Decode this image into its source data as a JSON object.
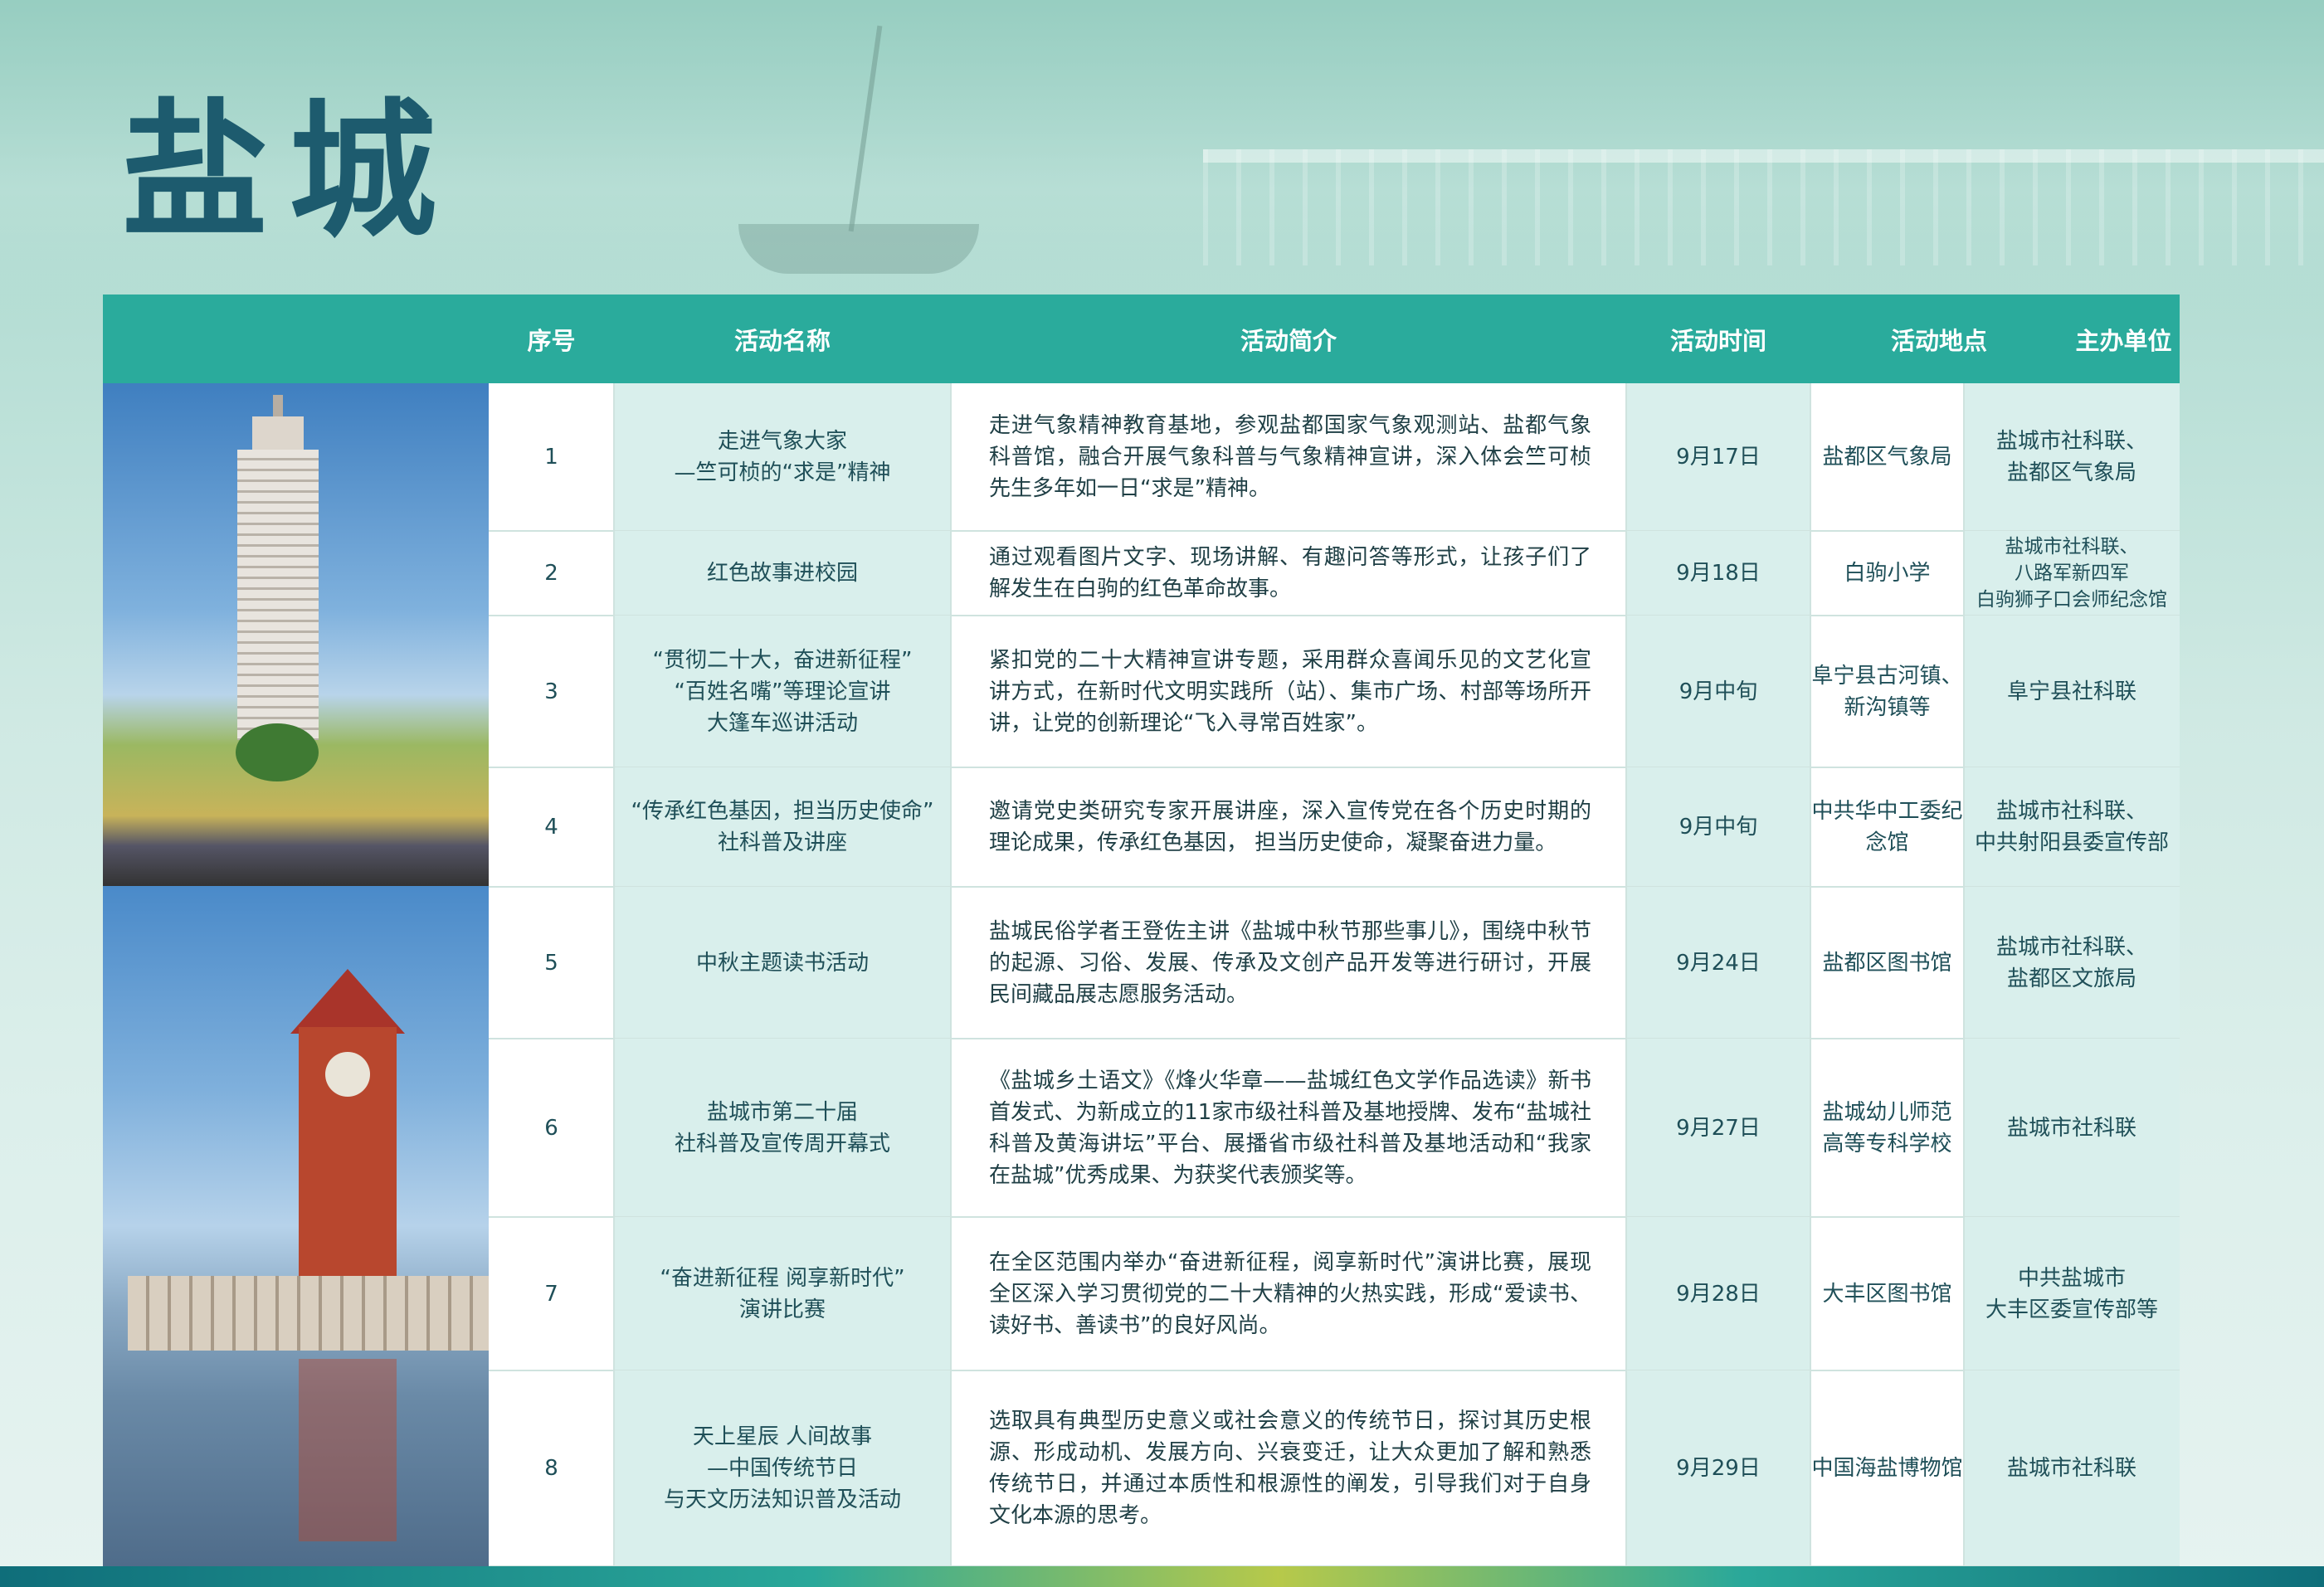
{
  "title": "盐城",
  "colors": {
    "header_bg": "#2aab9c",
    "title": "#1d5b6e",
    "shaded_cell": "#d9efec"
  },
  "table": {
    "headers": {
      "seq": "序号",
      "name": "活动名称",
      "desc": "活动简介",
      "time": "活动时间",
      "place": "活动地点",
      "host": "主办单位"
    },
    "rows": [
      {
        "seq": "1",
        "name": "走进气象大家\n—竺可桢的“求是”精神",
        "desc": "走进气象精神教育基地，参观盐都国家气象观测站、盐都气象科普馆，融合开展气象科普与气象精神宣讲，深入体会竺可桢先生多年如一日“求是”精神。",
        "time": "9月17日",
        "place": "盐都区气象局",
        "host": "盐城市社科联、\n盐都区气象局"
      },
      {
        "seq": "2",
        "name": "红色故事进校园",
        "desc": "通过观看图片文字、现场讲解、有趣问答等形式，让孩子们了解发生在白驹的红色革命故事。",
        "time": "9月18日",
        "place": "白驹小学",
        "host": "盐城市社科联、\n八路军新四军\n白驹狮子口会师纪念馆"
      },
      {
        "seq": "3",
        "name": "“贯彻二十大，奋进新征程”\n“百姓名嘴”等理论宣讲\n大篷车巡讲活动",
        "desc": "紧扣党的二十大精神宣讲专题，采用群众喜闻乐见的文艺化宣讲方式，在新时代文明实践所（站）、集市广场、村部等场所开讲，让党的创新理论“飞入寻常百姓家”。",
        "time": "9月中旬",
        "place": "阜宁县古河镇、\n新沟镇等",
        "host": "阜宁县社科联"
      },
      {
        "seq": "4",
        "name": "“传承红色基因，担当历史使命”\n社科普及讲座",
        "desc": "邀请党史类研究专家开展讲座，深入宣传党在各个历史时期的理论成果，传承红色基因， 担当历史使命，凝聚奋进力量。",
        "time": "9月中旬",
        "place": "中共华中工委纪念馆",
        "host": "盐城市社科联、\n中共射阳县委宣传部"
      },
      {
        "seq": "5",
        "name": "中秋主题读书活动",
        "desc": "盐城民俗学者王登佐主讲《盐城中秋节那些事儿》，围绕中秋节的起源、习俗、发展、传承及文创产品开发等进行研讨，开展民间藏品展志愿服务活动。",
        "time": "9月24日",
        "place": "盐都区图书馆",
        "host": "盐城市社科联、\n盐都区文旅局"
      },
      {
        "seq": "6",
        "name": "盐城市第二十届\n社科普及宣传周开幕式",
        "desc": "《盐城乡土语文》《烽火华章——盐城红色文学作品选读》新书首发式、为新成立的11家市级社科普及基地授牌、发布“盐城社科普及黄海讲坛”平台、展播省市级社科普及基地活动和“我家在盐城”优秀成果、为获奖代表颁奖等。",
        "time": "9月27日",
        "place": "盐城幼儿师范\n高等专科学校",
        "host": "盐城市社科联"
      },
      {
        "seq": "7",
        "name": "“奋进新征程 阅享新时代”\n演讲比赛",
        "desc": "在全区范围内举办“奋进新征程，阅享新时代”演讲比赛，展现全区深入学习贯彻党的二十大精神的火热实践，形成“爱读书、读好书、善读书”的良好风尚。",
        "time": "9月28日",
        "place": "大丰区图书馆",
        "host": "中共盐城市\n大丰区委宣传部等"
      },
      {
        "seq": "8",
        "name": "天上星辰 人间故事\n—中国传统节日\n与天文历法知识普及活动",
        "desc": "选取具有典型历史意义或社会意义的传统节日，探讨其历史根源、形成动机、发展方向、兴衰变迁，让大众更加了解和熟悉传统节日，并通过本质性和根源性的阐发，引导我们对于自身文化本源的思考。",
        "time": "9月29日",
        "place": "中国海盐博物馆",
        "host": "盐城市社科联"
      }
    ]
  }
}
